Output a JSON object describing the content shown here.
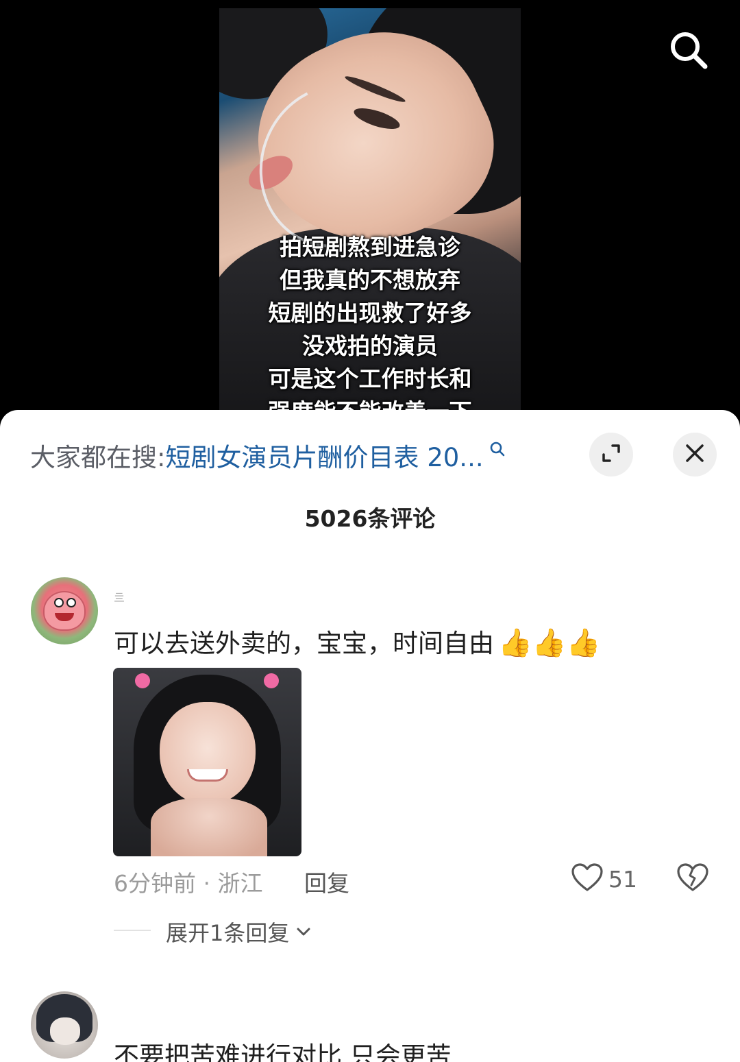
{
  "video": {
    "overlay_lines": [
      "拍短剧熬到进急诊",
      "但我真的不想放弃",
      "短剧的出现救了好多",
      "没戏拍的演员",
      "可是这个工作时长和",
      "强度能不能改善一下"
    ],
    "search_icon": "search-icon"
  },
  "sheet": {
    "search_prefix": "大家都在搜:",
    "search_query": "短剧女演员片酬价目表 20...",
    "expand_icon": "expand-icon",
    "close_icon": "close-icon",
    "comment_count": "5026条评论"
  },
  "comments": [
    {
      "username": "亖",
      "text": "可以去送外卖的，宝宝，时间自由",
      "emoji": "👍👍👍",
      "meta": "6分钟前 · 浙江",
      "reply_label": "回复",
      "likes": "51",
      "expand_replies": "展开1条回复"
    },
    {
      "username": "",
      "text": "不要把苦难进行对比 只会更苦"
    }
  ],
  "colors": {
    "link": "#1f5fa0",
    "muted": "#9b9b9b",
    "text": "#1f1f1f"
  }
}
